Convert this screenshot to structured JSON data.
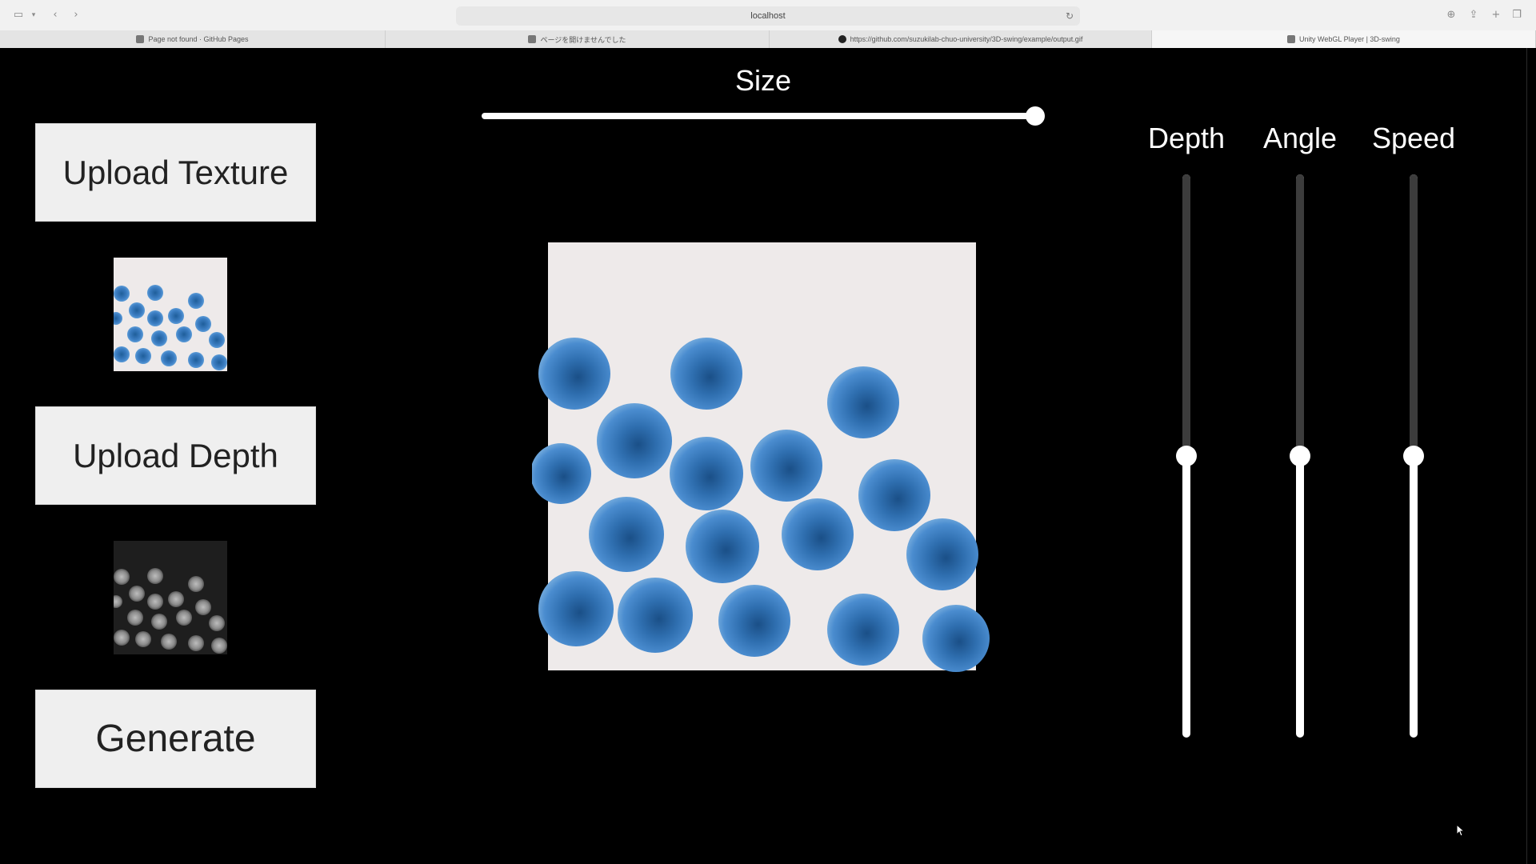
{
  "browser": {
    "url": "localhost",
    "tabs": [
      {
        "title": "Page not found · GitHub Pages",
        "active": false,
        "favicon": "generic-page-icon"
      },
      {
        "title": "ページを開けませんでした",
        "active": false,
        "favicon": "generic-page-icon"
      },
      {
        "title": "https://github.com/suzukilab-chuo-university/3D-swing/example/output.gif",
        "active": false,
        "favicon": "github-icon"
      },
      {
        "title": "Unity WebGL Player | 3D-swing",
        "active": true,
        "favicon": "unity-icon"
      }
    ]
  },
  "app": {
    "upload_texture_label": "Upload Texture",
    "upload_depth_label": "Upload Depth",
    "generate_label": "Generate",
    "size": {
      "label": "Size",
      "value_fraction": 0.98
    },
    "sliders": [
      {
        "label": "Depth",
        "value_fraction": 0.5
      },
      {
        "label": "Angle",
        "value_fraction": 0.5
      },
      {
        "label": "Speed",
        "value_fraction": 0.5
      }
    ]
  },
  "colors": {
    "background": "#000000",
    "button_bg": "#efefef",
    "dot_blue": "#3d7fc4",
    "texture_bg": "#eeeaea"
  }
}
